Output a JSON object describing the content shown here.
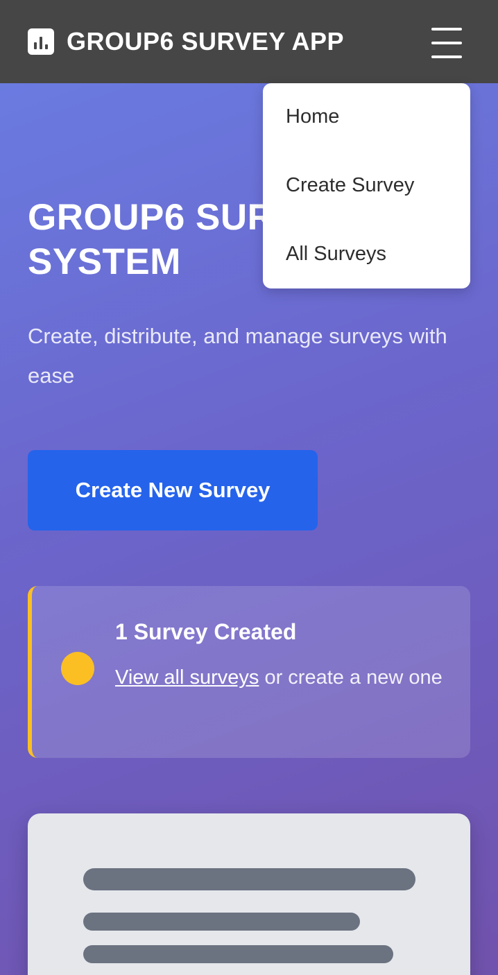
{
  "app": {
    "title": "GROUP6 SURVEY APP",
    "logo_icon": "bar-chart-icon",
    "menu_icon": "hamburger-menu-icon"
  },
  "nav_menu": {
    "items": [
      {
        "label": "Home"
      },
      {
        "label": "Create Survey"
      },
      {
        "label": "All Surveys"
      }
    ]
  },
  "hero": {
    "title_line1": "GROUP6 SURVEY",
    "title_line2": "SYSTEM",
    "subtitle": "Create, distribute, and manage surveys with ease",
    "cta_label": "Create New Survey"
  },
  "notice": {
    "title": "1 Survey Created",
    "link_text": "View all surveys",
    "body_rest": " or create a new one",
    "accent": "#fbbf24"
  },
  "colors": {
    "topbar": "#464646",
    "primary": "#2563eb",
    "gradient_start": "#6a7fe4",
    "gradient_end": "#7152ad"
  }
}
